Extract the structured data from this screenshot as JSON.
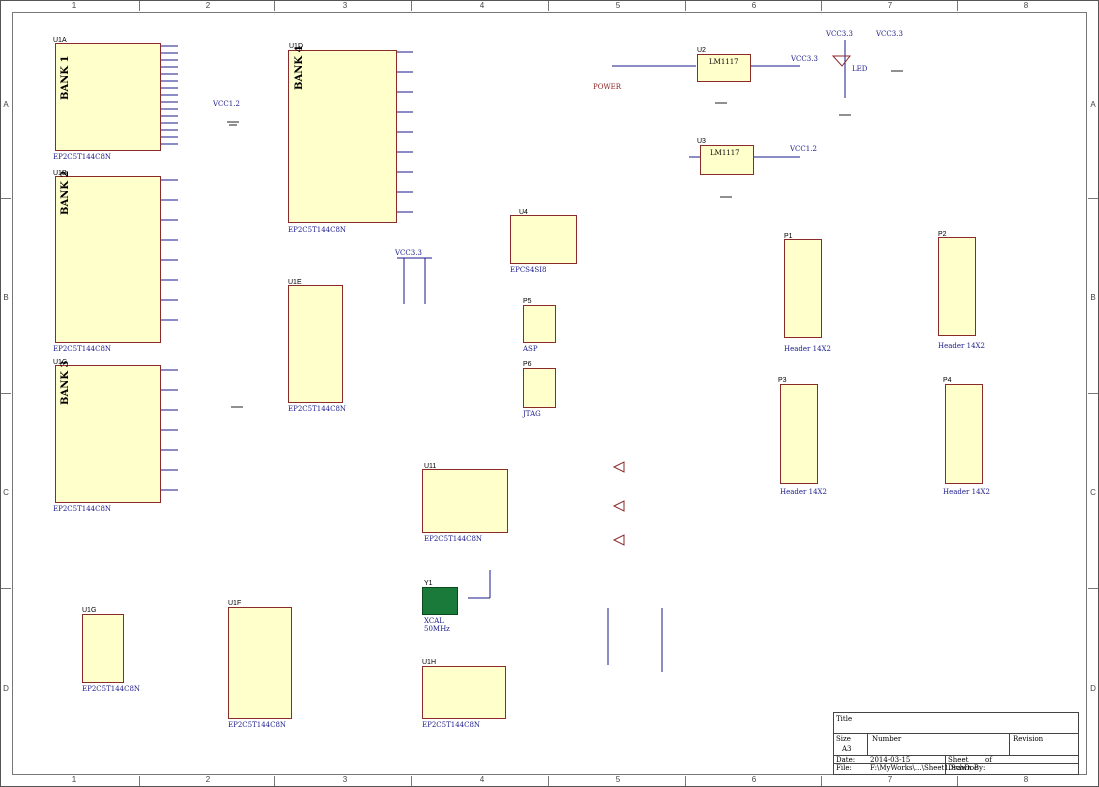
{
  "border": {
    "columns": [
      "1",
      "2",
      "3",
      "4",
      "5",
      "6",
      "7",
      "8"
    ],
    "rows": [
      "A",
      "B",
      "C",
      "D"
    ]
  },
  "blocks": {
    "u1a": {
      "ref": "U1A",
      "bank": "BANK 1",
      "part": "EP2C5T144C8N"
    },
    "u1b": {
      "ref": "U1B",
      "bank": "BANK 2",
      "part": "EP2C5T144C8N"
    },
    "u1c": {
      "ref": "U1C",
      "bank": "BANK 3",
      "part": "EP2C5T144C8N"
    },
    "u1d": {
      "ref": "U1D",
      "bank": "BANK 4",
      "part": "EP2C5T144C8N"
    },
    "u1e": {
      "ref": "U1E",
      "part": "EP2C5T144C8N"
    },
    "u1f": {
      "ref": "U1F",
      "part": "EP2C5T144C8N"
    },
    "u1g": {
      "ref": "U1G",
      "part": "EP2C5T144C8N"
    },
    "u1h": {
      "ref": "U1H",
      "part": "EP2C5T144C8N"
    },
    "u11": {
      "ref": "U11",
      "part": "EP2C5T144C8N"
    },
    "u2": {
      "ref": "U2",
      "part": "LM1117"
    },
    "u3": {
      "ref": "U3",
      "part": "LM1117"
    },
    "u4": {
      "ref": "U4",
      "part": "EPCS4SI8"
    },
    "p1": {
      "ref": "P1",
      "part": "Header 14X2"
    },
    "p2": {
      "ref": "P2",
      "part": "Header 14X2"
    },
    "p3": {
      "ref": "P3",
      "part": "Header 14X2"
    },
    "p4": {
      "ref": "P4",
      "part": "Header 14X2"
    },
    "p5": {
      "ref": "P5",
      "part": "ASP"
    },
    "p6": {
      "ref": "P6",
      "part": "JTAG"
    },
    "y1": {
      "ref": "Y1",
      "part": "XCAL",
      "freq": "50MHz"
    }
  },
  "nets": {
    "power_label": "POWER",
    "led_label": "LED",
    "vcc33": "VCC3.3",
    "vcc12": "VCC1.2"
  },
  "title_block": {
    "title_label": "Title",
    "size_label": "Size",
    "size_value": "A3",
    "number_label": "Number",
    "revision_label": "Revision",
    "date_label": "Date:",
    "date_value": "2014-03-15",
    "file_label": "File:",
    "file_value": "F:\\MyWorks\\...\\Sheet1.SchDoc",
    "sheet_label": "Sheet",
    "sheet_of": "of",
    "drawn_label": "Drawn By:"
  }
}
